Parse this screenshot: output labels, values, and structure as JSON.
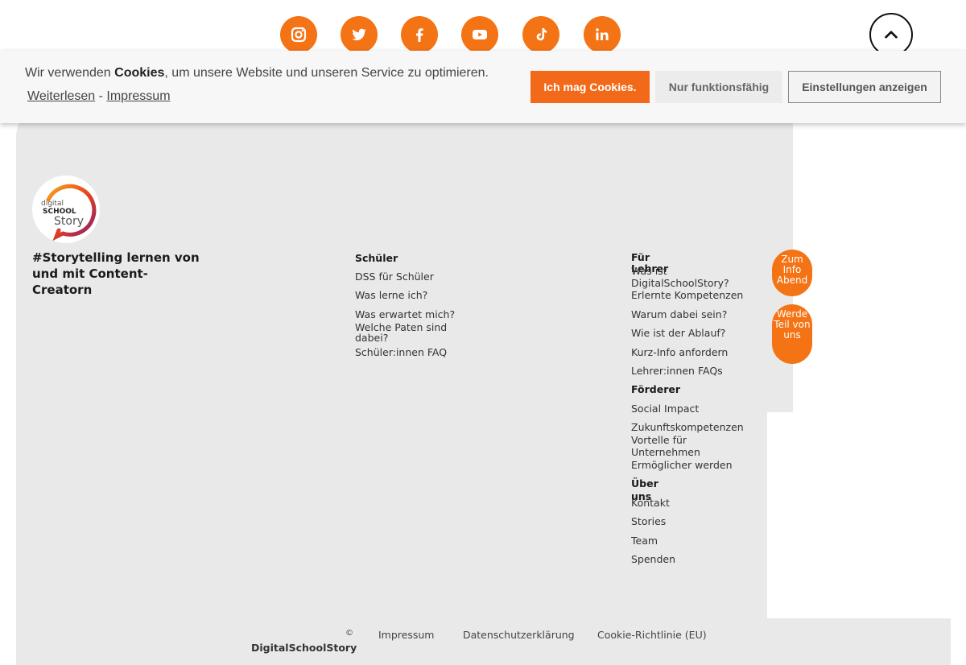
{
  "social": {
    "icons": [
      "instagram-icon",
      "twitter-icon",
      "facebook-icon",
      "youtube-icon",
      "tiktok-icon",
      "linkedin-icon"
    ],
    "color": "#f47315"
  },
  "cookie_banner": {
    "text_before": "Wir verwenden ",
    "text_bold": "Cookies",
    "text_after": ", um unsere Website und unseren Service zu optimieren.",
    "link_read_more": "Weiterlesen",
    "link_separator": " - ",
    "link_imprint": "Impressum",
    "accept_label": "Ich mag Cookies.",
    "functional_label": "Nur funktionsfähig",
    "settings_label": "Einstellungen anzeigen",
    "accent_color": "#f26a19"
  },
  "brand": {
    "logo_line1": "digital",
    "logo_line2": "SCHOOL",
    "logo_line3": "Story",
    "tagline": "#Storytelling lernen von und mit Content-Creatorn"
  },
  "footer_nav": {
    "students": {
      "heading": "Schüler",
      "items": [
        "DSS für Schüler",
        "Was lerne ich?",
        "Was erwartet mich?",
        "Welche Paten sind dabei?",
        "Schüler:innen FAQ"
      ]
    },
    "teachers": {
      "heading": "Für Lehrer",
      "items": [
        "Was ist DigitalSchoolStory?",
        "Erlernte Kompetenzen",
        "Warum dabei sein?",
        "Wie ist der Ablauf?",
        "Kurz-Info anfordern",
        "Lehrer:innen FAQs"
      ]
    },
    "sponsors": {
      "heading": "Förderer",
      "items": [
        "Social Impact",
        "Zukunftskompetenzen",
        "Vortelle für Unternehmen",
        "Ermöglicher werden"
      ]
    },
    "about": {
      "heading": "Über uns",
      "items": [
        "Kontakt",
        "Stories",
        "Team",
        "Spenden"
      ]
    }
  },
  "side_buttons": {
    "info_evening": "Zum Info Abend",
    "join": "Werde Teil von uns"
  },
  "footer_bottom": {
    "copyright_symbol": "©",
    "copyright_name": "DigitalSchoolStory",
    "imprint": "Impressum",
    "privacy": "Datenschutzerklärung",
    "cookie_policy": "Cookie-Richtlinie (EU)"
  }
}
